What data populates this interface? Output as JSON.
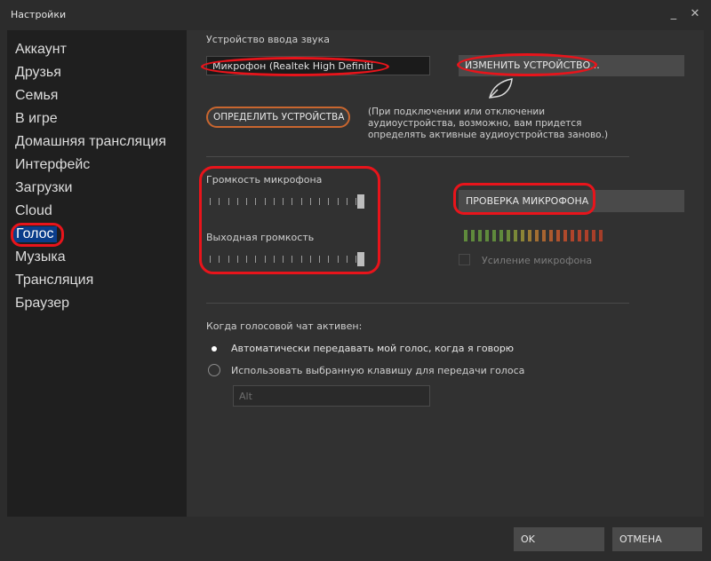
{
  "window": {
    "title": "Настройки",
    "minimize": "_",
    "close": "✕"
  },
  "sidebar": {
    "items": [
      {
        "label": "Аккаунт"
      },
      {
        "label": "Друзья"
      },
      {
        "label": "Семья"
      },
      {
        "label": "В игре"
      },
      {
        "label": "Домашняя трансляция"
      },
      {
        "label": "Интерфейс"
      },
      {
        "label": "Загрузки"
      },
      {
        "label": "Cloud"
      },
      {
        "label": "Голос"
      },
      {
        "label": "Музыка"
      },
      {
        "label": "Трансляция"
      },
      {
        "label": "Браузер"
      }
    ]
  },
  "voice": {
    "input_device_label": "Устройство ввода звука",
    "input_device_value": "Микрофон (Realtek High Definiti",
    "change_device_button": "ИЗМЕНИТЬ УСТРОЙСТВО...",
    "detect_devices_button": "ОПРЕДЕЛИТЬ УСТРОЙСТВА",
    "detect_note": "(При подключении или отключении аудиоустройства, возможно, вам придется определять активные аудиоустройства заново.)",
    "mic_volume_label": "Громкость микрофона",
    "mic_volume_level": 1.0,
    "output_volume_label": "Выходная громкость",
    "output_volume_level": 1.0,
    "test_mic_button": "ПРОВЕРКА МИКРОФОНА",
    "mic_boost_label": "Усиление микрофона",
    "mic_boost_checked": false,
    "meter_colors": [
      "#5f8a3c",
      "#5f8a3c",
      "#5f8a3c",
      "#5f8a3c",
      "#5f8a3c",
      "#5f8a3c",
      "#6b8a3a",
      "#7a8838",
      "#8c8436",
      "#9a7a34",
      "#a26e32",
      "#a86430",
      "#ac5a2e",
      "#b0522d",
      "#b04a2c",
      "#b0442b",
      "#b0422b",
      "#ad402a",
      "#a83f29",
      "#a53e29"
    ],
    "active_label": "Когда голосовой чат активен:",
    "option_auto": "Автоматически передавать мой голос, когда я говорю",
    "option_key": "Использовать выбранную клавишу для передачи голоса",
    "selected_option": "auto",
    "key_value": "Alt"
  },
  "footer": {
    "ok": "OK",
    "cancel": "ОТМЕНА"
  },
  "colors": {
    "annotation": "#e8141b",
    "panel": "#313131",
    "sidebar": "#1f1f1f"
  }
}
